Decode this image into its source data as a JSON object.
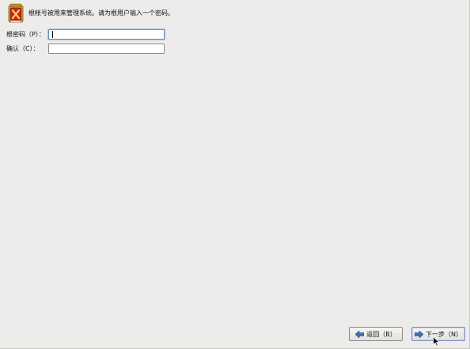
{
  "header": {
    "message": "根帐号被用来管理系统。请为根用户输入一个密码。"
  },
  "form": {
    "password_label": "根密码（P）：",
    "password_value": "",
    "confirm_label": "确认（C）：",
    "confirm_value": ""
  },
  "buttons": {
    "back_label": "返回（B）",
    "next_label": "下一步（N）"
  },
  "colors": {
    "background": "#edecea",
    "arrow": "#3c6fb4",
    "icon_red": "#c8251b",
    "icon_gold": "#d9b13a"
  },
  "icons": {
    "header": "root-shield-icon",
    "back": "arrow-left-icon",
    "next": "arrow-right-icon"
  }
}
